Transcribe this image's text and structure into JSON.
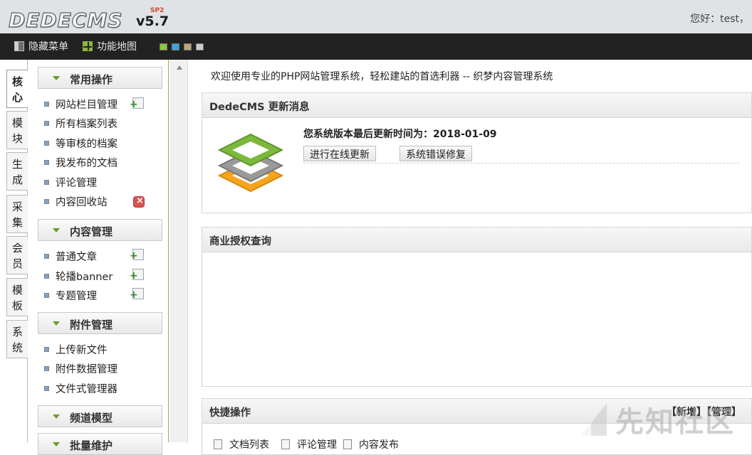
{
  "header": {
    "logo": {
      "brand": "DEDECMS",
      "version": "v5.7",
      "sp": "SP2"
    },
    "greeting": "您好：test，"
  },
  "toolbar": {
    "hide_menu": "隐藏菜单",
    "function_map": "功能地图",
    "skins": [
      {
        "name": "green",
        "color": "#8fc43c"
      },
      {
        "name": "blue",
        "color": "#3ba6d9"
      },
      {
        "name": "brown",
        "color": "#b9a776"
      },
      {
        "name": "gray",
        "color": "#cccccc"
      }
    ]
  },
  "vtabs": [
    "核心",
    "模块",
    "生成",
    "采集",
    "会员",
    "模板",
    "系统"
  ],
  "menu": {
    "groups": [
      {
        "title": "常用操作",
        "items": [
          {
            "label": "网站栏目管理",
            "action": "add"
          },
          {
            "label": "所有档案列表"
          },
          {
            "label": "等审核的档案"
          },
          {
            "label": "我发布的文档"
          },
          {
            "label": "评论管理"
          },
          {
            "label": "内容回收站",
            "action": "delete"
          }
        ]
      },
      {
        "title": "内容管理",
        "items": [
          {
            "label": "普通文章",
            "action": "add"
          },
          {
            "label": "轮播banner",
            "action": "add"
          },
          {
            "label": "专题管理",
            "action": "add"
          }
        ]
      },
      {
        "title": "附件管理",
        "items": [
          {
            "label": "上传新文件"
          },
          {
            "label": "附件数据管理"
          },
          {
            "label": "文件式管理器"
          }
        ]
      },
      {
        "title": "频道模型",
        "items": []
      },
      {
        "title": "批量维护",
        "items": []
      }
    ]
  },
  "main": {
    "welcome": "欢迎使用专业的PHP网站管理系统，轻松建站的首选利器 -- 织梦内容管理系统",
    "update_panel": {
      "title": "DedeCMS 更新消息",
      "last_update": "您系统版本最后更新时间为：2018-01-09",
      "online_update_button": "进行在线更新",
      "fix_button": "系统错误修复"
    },
    "license_panel": {
      "title": "商业授权查询"
    },
    "quick_panel": {
      "title": "快捷操作",
      "add_link": "【新增】",
      "manage_link": "【管理】",
      "items": [
        "文档列表",
        "评论管理",
        "内容发布"
      ]
    }
  },
  "watermark": "先知社区"
}
